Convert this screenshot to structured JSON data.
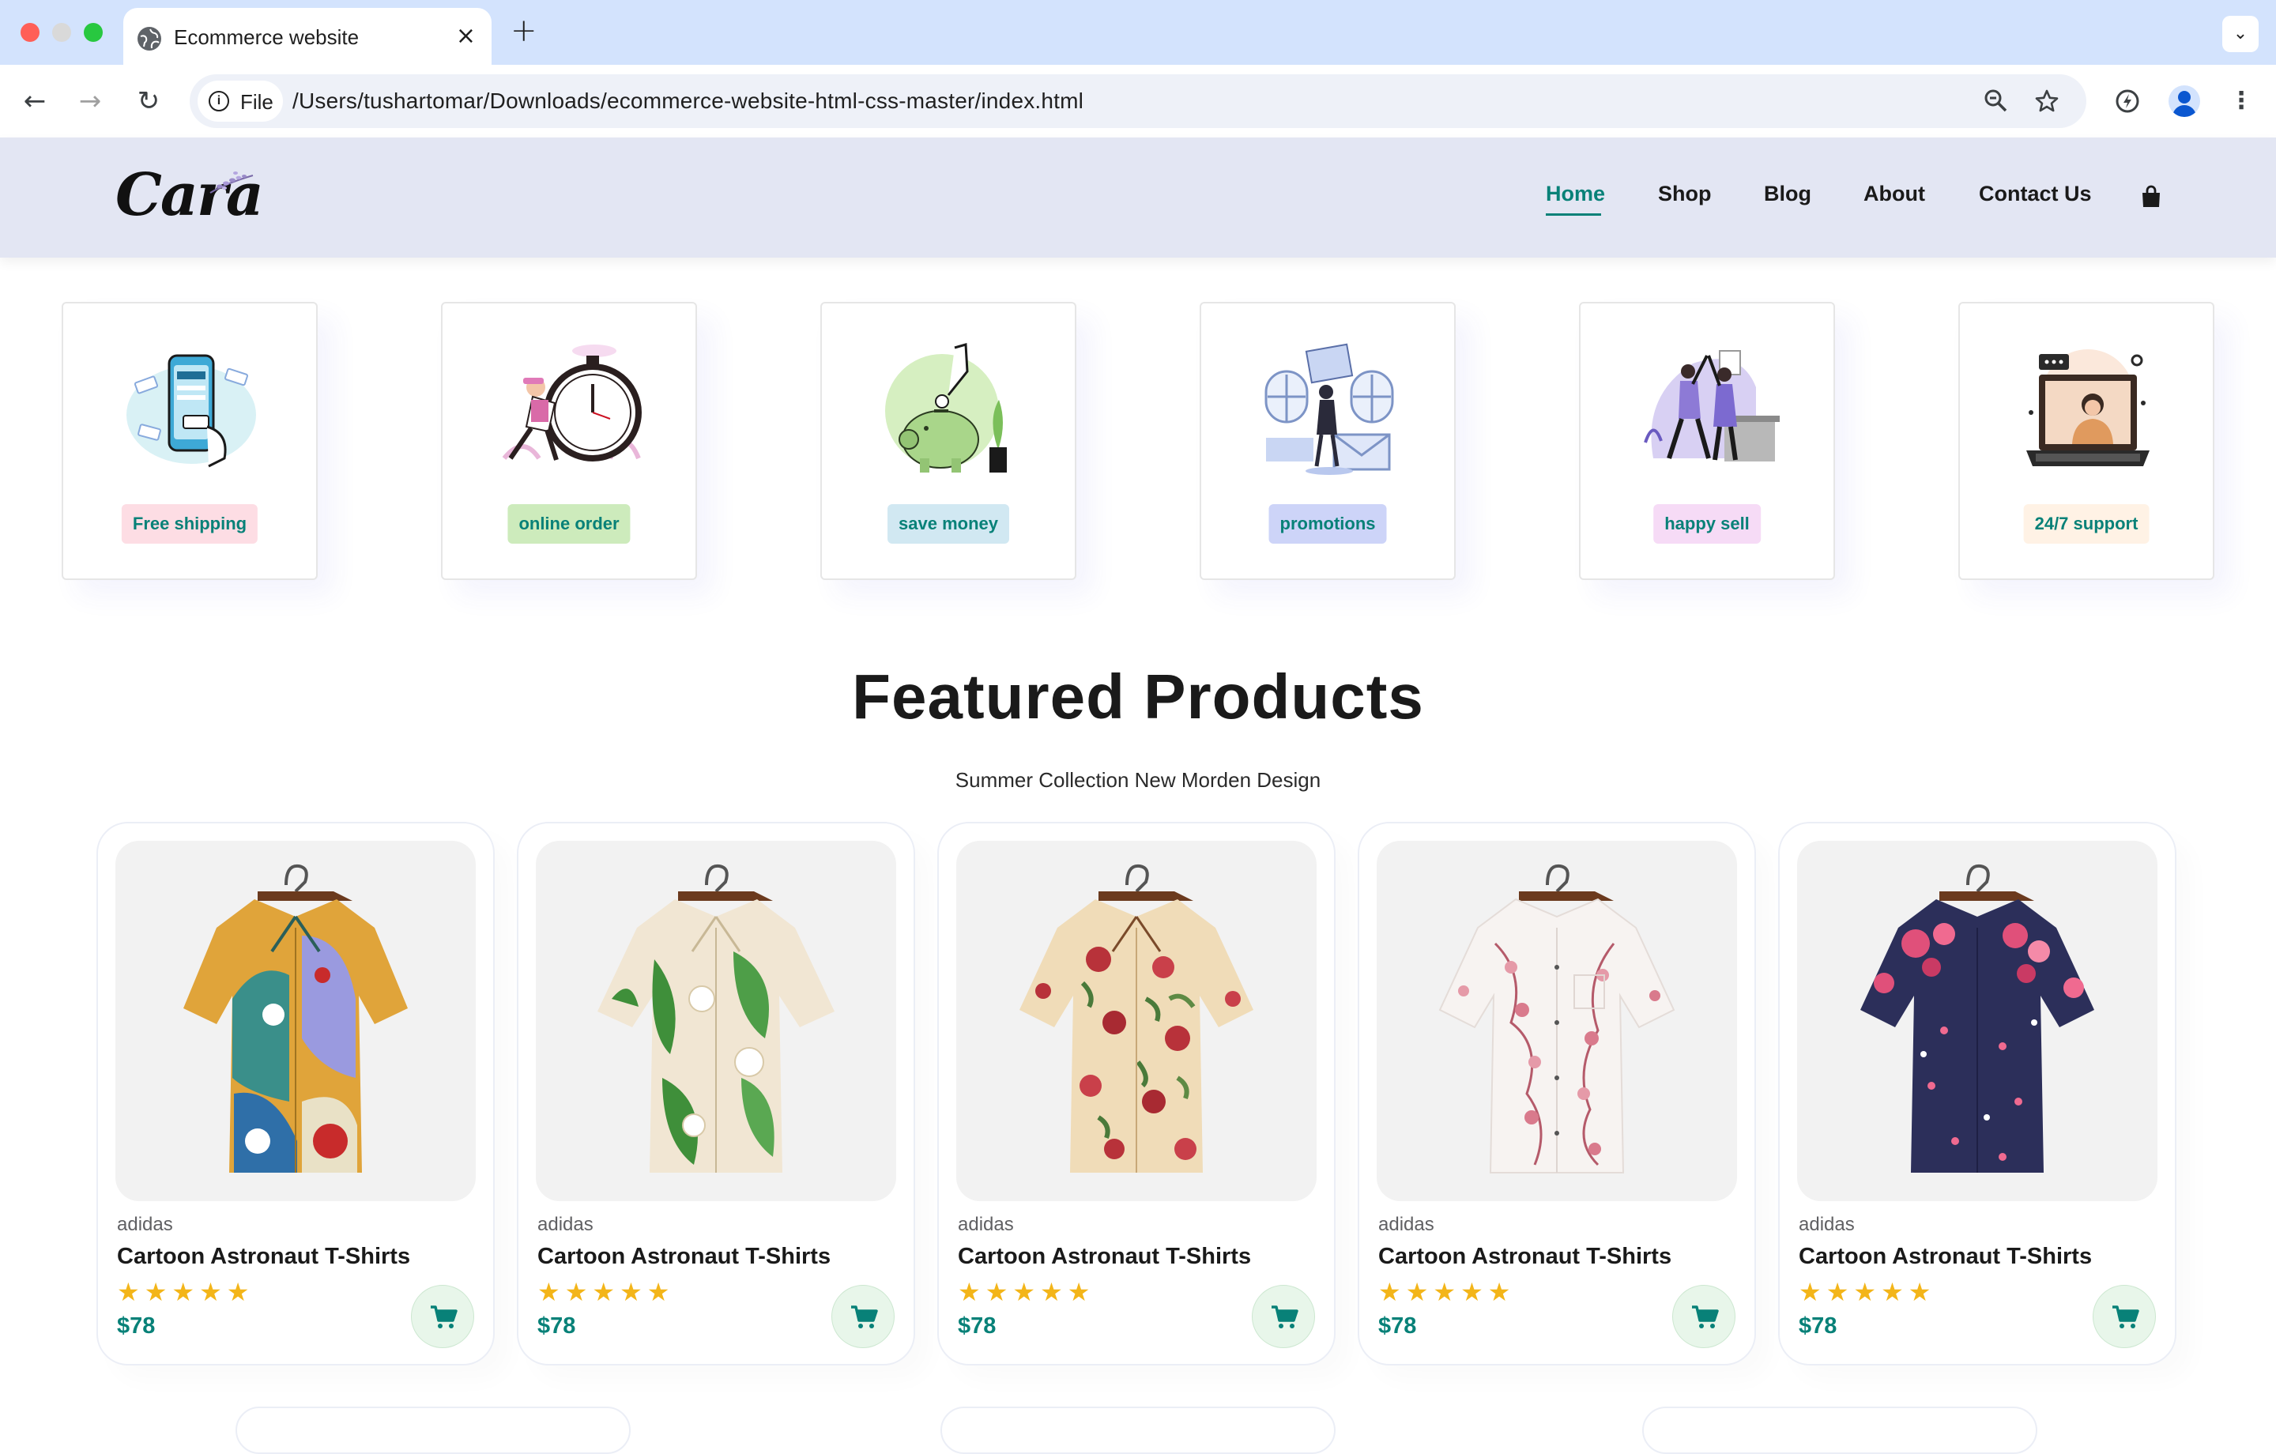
{
  "browser": {
    "tab_title": "Ecommerce website",
    "tab_close": "×",
    "new_tab": "+",
    "chip_label": "File",
    "url": "/Users/tushartomar/Downloads/ecommerce-website-html-css-master/index.html",
    "icons": [
      "globe-icon",
      "info-icon",
      "zoom-icon",
      "star-icon",
      "extension-icon",
      "profile-icon",
      "kebab-menu-icon",
      "back-icon",
      "forward-icon",
      "reload-icon",
      "chevron-down-icon"
    ]
  },
  "site": {
    "logo": "Cara",
    "nav": [
      {
        "label": "Home",
        "active": true
      },
      {
        "label": "Shop"
      },
      {
        "label": "Blog"
      },
      {
        "label": "About"
      },
      {
        "label": "Contact Us"
      }
    ],
    "cart_icon": "shopping-bag-icon",
    "accent_color": "#088178"
  },
  "features": [
    {
      "label": "Free shipping",
      "bg": "#fddde4"
    },
    {
      "label": "online order",
      "bg": "#cdebbc"
    },
    {
      "label": "save money",
      "bg": "#d1e8f2"
    },
    {
      "label": "promotions",
      "bg": "#cdd4f8"
    },
    {
      "label": "happy sell",
      "bg": "#f6dbf6"
    },
    {
      "label": "24/7 support",
      "bg": "#fff2e5"
    }
  ],
  "featured": {
    "title": "Featured Products",
    "subtitle": "Summer Collection New Morden Design"
  },
  "products": [
    {
      "brand": "adidas",
      "name": "Cartoon Astronaut T-Shirts",
      "stars": "★★★★★",
      "rating": 5,
      "price": "$78"
    },
    {
      "brand": "adidas",
      "name": "Cartoon Astronaut T-Shirts",
      "stars": "★★★★★",
      "rating": 5,
      "price": "$78"
    },
    {
      "brand": "adidas",
      "name": "Cartoon Astronaut T-Shirts",
      "stars": "★★★★★",
      "rating": 5,
      "price": "$78"
    },
    {
      "brand": "adidas",
      "name": "Cartoon Astronaut T-Shirts",
      "stars": "★★★★★",
      "rating": 5,
      "price": "$78"
    },
    {
      "brand": "adidas",
      "name": "Cartoon Astronaut T-Shirts",
      "stars": "★★★★★",
      "rating": 5,
      "price": "$78"
    }
  ]
}
